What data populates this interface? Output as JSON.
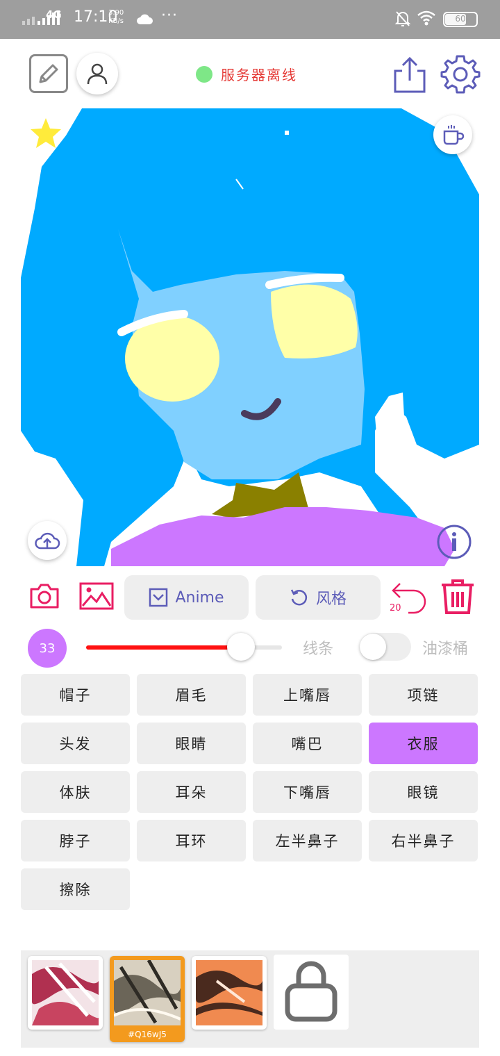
{
  "status_bar": {
    "network": "4G",
    "time": "17:10",
    "speed_value": "3.90",
    "speed_unit": "KB/s",
    "more": "···",
    "battery": "60"
  },
  "header": {
    "server_status": "服务器离线",
    "server_status_color": "#7ee787"
  },
  "actions": {
    "anime_label": "Anime",
    "style_label": "风格",
    "undo_count": "20"
  },
  "brush": {
    "size": "33",
    "size_fraction": 0.79,
    "line_label": "线条",
    "bucket_label": "油漆桶",
    "bucket_enabled": false,
    "stroke_color": "#ff1111"
  },
  "parts": {
    "items": [
      {
        "label": "帽子",
        "active": false
      },
      {
        "label": "眉毛",
        "active": false
      },
      {
        "label": "上嘴唇",
        "active": false
      },
      {
        "label": "项链",
        "active": false
      },
      {
        "label": "头发",
        "active": false
      },
      {
        "label": "眼睛",
        "active": false
      },
      {
        "label": "嘴巴",
        "active": false
      },
      {
        "label": "衣服",
        "active": true
      },
      {
        "label": "体肤",
        "active": false
      },
      {
        "label": "耳朵",
        "active": false
      },
      {
        "label": "下嘴唇",
        "active": false
      },
      {
        "label": "眼镜",
        "active": false
      },
      {
        "label": "脖子",
        "active": false
      },
      {
        "label": "耳环",
        "active": false
      },
      {
        "label": "左半鼻子",
        "active": false
      },
      {
        "label": "右半鼻子",
        "active": false
      },
      {
        "label": "擦除",
        "active": false
      }
    ]
  },
  "gallery": {
    "selected_code": "#Q16wJ5"
  },
  "colors": {
    "accent_purple": "#cc77ff",
    "icon_blue": "#5c5cb8",
    "icon_red": "#e91e63",
    "hair": "#00aaff",
    "skin": "#80d0ff",
    "clothes": "#cc77ff"
  }
}
